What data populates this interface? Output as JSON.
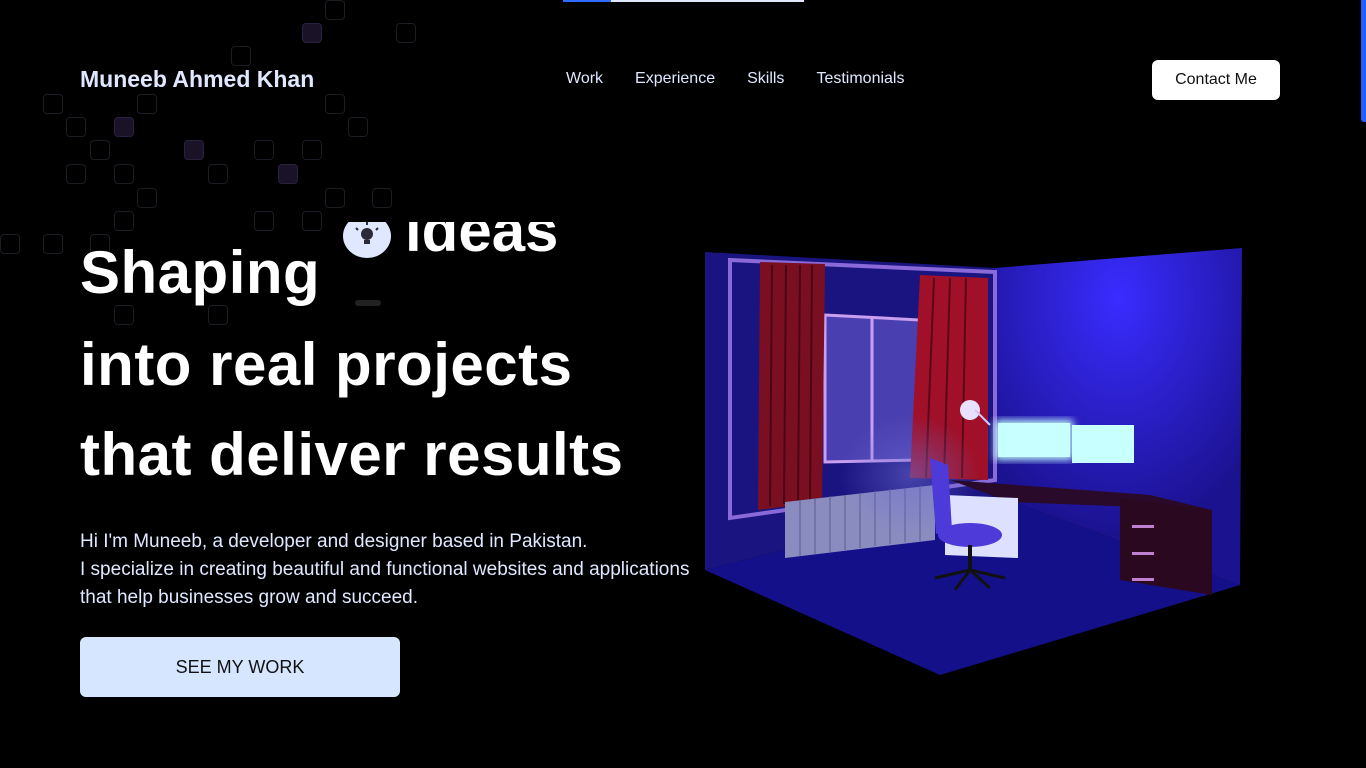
{
  "header": {
    "brand": "Muneeb Ahmed Khan",
    "nav": [
      {
        "label": "Work"
      },
      {
        "label": "Experience"
      },
      {
        "label": "Skills"
      },
      {
        "label": "Testimonials"
      }
    ],
    "contact_label": "Contact Me"
  },
  "hero": {
    "line1_word": "Shaping",
    "rotating_word": "ideas",
    "line2": "into real projects",
    "line3": "that deliver results",
    "intro": [
      "Hi I'm Muneeb, a developer and designer based in Pakistan.",
      "I specialize in creating beautiful and functional websites and applications",
      "that help businesses grow and succeed."
    ],
    "cta_label": "SEE MY WORK"
  },
  "icons": {
    "hero_badge": "lightbulb-icon",
    "illustration": "room-desk-illustration"
  },
  "colors": {
    "background": "#000000",
    "text_primary": "#ffffff",
    "text_soft": "#dfe8ff",
    "cta_background": "#d6e6ff",
    "accent_blue": "#2f6bff",
    "room_blue": "#1a12a8"
  }
}
